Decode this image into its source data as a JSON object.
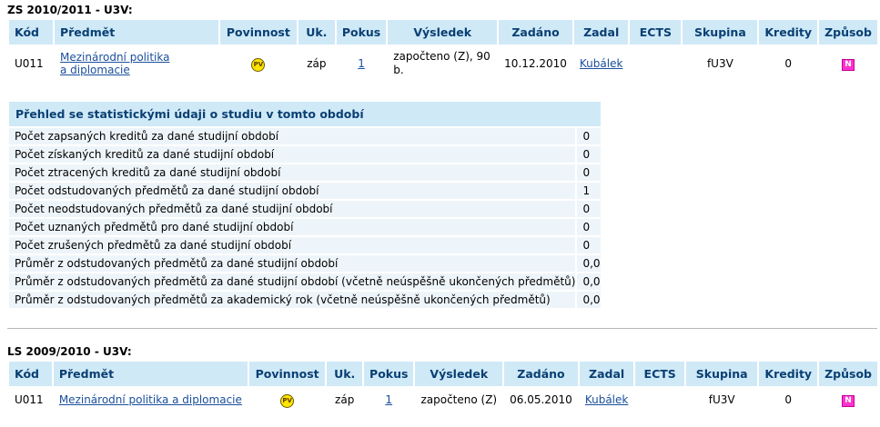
{
  "section1": {
    "title": "ZS 2010/2011 - U3V:",
    "headers": [
      "Kód",
      "Předmět",
      "Povinnost",
      "Uk.",
      "Pokus",
      "Výsledek",
      "Zadáno",
      "Zadal",
      "ECTS",
      "Skupina",
      "Kredity",
      "Způsob"
    ],
    "row": {
      "kod": "U011",
      "predmet_line1": "Mezinárodní politika",
      "predmet_line2": "a diplomacie",
      "povinnost": "PV",
      "uk": "záp",
      "pokus": "1",
      "vysledek": "započteno (Z), 90 b.",
      "zadano": "10.12.2010",
      "zadal": "Kubálek",
      "ects": "",
      "skupina": "fU3V",
      "kredity": "0",
      "zpusob": "N"
    }
  },
  "stats": {
    "title": "Přehled se statistickými údaji o studiu v tomto období",
    "rows": [
      {
        "label": "Počet zapsaných kreditů za dané studijní období",
        "value": "0"
      },
      {
        "label": "Počet získaných kreditů za dané studijní období",
        "value": "0"
      },
      {
        "label": "Počet ztracených kreditů za dané studijní období",
        "value": "0"
      },
      {
        "label": "Počet odstudovaných předmětů za dané studijní období",
        "value": "1"
      },
      {
        "label": "Počet neodstudovaných předmětů za dané studijní období",
        "value": "0"
      },
      {
        "label": "Počet uznaných předmětů pro dané studijní období",
        "value": "0"
      },
      {
        "label": "Počet zrušených předmětů za dané studijní období",
        "value": "0"
      },
      {
        "label": "Průměr z odstudovaných předmětů za dané studijní období",
        "value": "0,0"
      },
      {
        "label": "Průměr z odstudovaných předmětů za dané studijní období (včetně neúspěšně ukončených předmětů)",
        "value": "0,0"
      },
      {
        "label": "Průměr z odstudovaných předmětů za akademický rok (včetně neúspěšně ukončených předmětů)",
        "value": "0,0"
      }
    ]
  },
  "section2": {
    "title": "LS 2009/2010 - U3V:",
    "headers": [
      "Kód",
      "Předmět",
      "Povinnost",
      "Uk.",
      "Pokus",
      "Výsledek",
      "Zadáno",
      "Zadal",
      "ECTS",
      "Skupina",
      "Kredity",
      "Způsob"
    ],
    "row": {
      "kod": "U011",
      "predmet": "Mezinárodní politika a diplomacie",
      "povinnost": "PV",
      "uk": "záp",
      "pokus": "1",
      "vysledek": "započteno (Z)",
      "zadano": "06.05.2010",
      "zadal": "Kubálek",
      "ects": "",
      "skupina": "fU3V",
      "kredity": "0",
      "zpusob": "N"
    }
  },
  "colors": {
    "header_bg": "#cfe9f7",
    "header_text": "#0a3f73",
    "row_bg": "#eef5fa",
    "link": "#1a4f9c",
    "badge_n": "#ff33cc",
    "badge_pv": "#ffe400"
  }
}
